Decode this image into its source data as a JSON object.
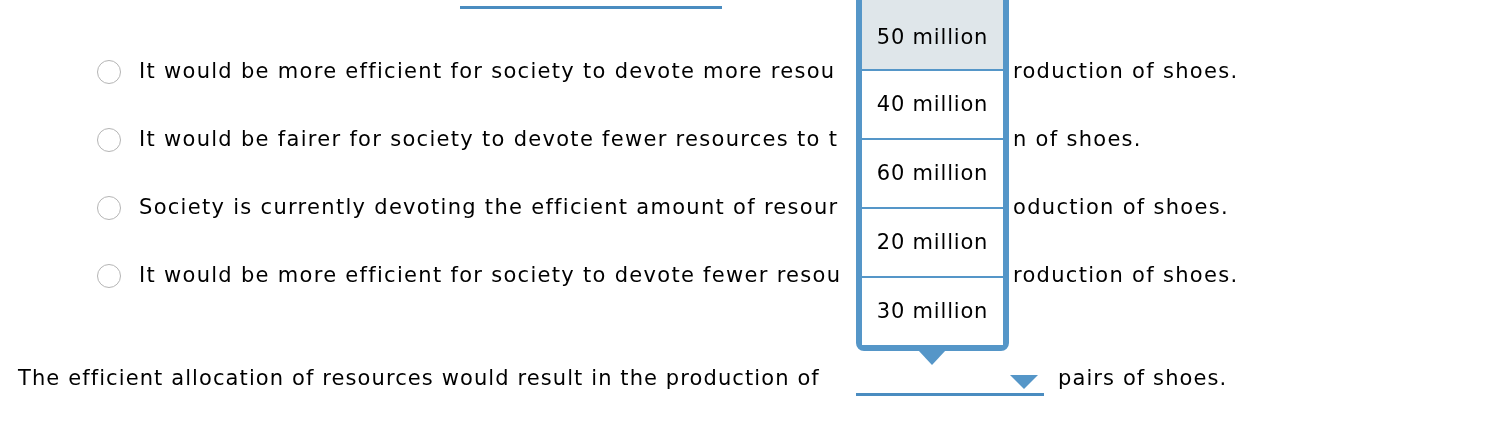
{
  "options": [
    {
      "selected": false,
      "text_left": "It would be more efficient for society to devote more resou",
      "text_right": "roduction of shoes."
    },
    {
      "selected": false,
      "text_left": "It would be fairer for society to devote fewer resources to t",
      "text_right": "n of shoes."
    },
    {
      "selected": false,
      "text_left": "Society is currently devoting the efficient amount of resour",
      "text_right": "oduction of shoes."
    },
    {
      "selected": false,
      "text_left": "It would be more efficient for society to devote fewer resou",
      "text_right": "roduction of shoes."
    }
  ],
  "sentence": {
    "before": "The efficient allocation of resources would result in the production of",
    "after": "pairs of shoes."
  },
  "dropdown_menu": {
    "items": [
      {
        "label": "50 million",
        "highlighted": true
      },
      {
        "label": "40 million",
        "highlighted": false
      },
      {
        "label": "60 million",
        "highlighted": false
      },
      {
        "label": "20 million",
        "highlighted": false
      },
      {
        "label": "30 million",
        "highlighted": false
      }
    ]
  }
}
